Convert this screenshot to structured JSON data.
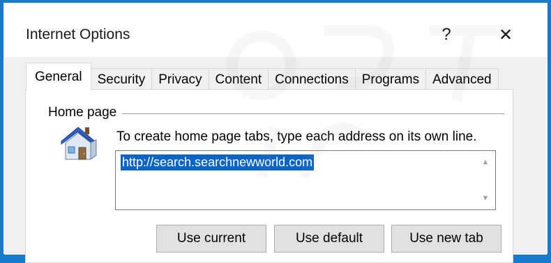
{
  "window": {
    "title": "Internet Options",
    "help_label": "?",
    "close_label": "✕"
  },
  "tabs": [
    {
      "label": "General",
      "active": true
    },
    {
      "label": "Security"
    },
    {
      "label": "Privacy"
    },
    {
      "label": "Content"
    },
    {
      "label": "Connections"
    },
    {
      "label": "Programs"
    },
    {
      "label": "Advanced"
    }
  ],
  "home_page": {
    "group_label": "Home page",
    "instruction": "To create home page tabs, type each address on its own line.",
    "url_value": "http://search.searchnewworld.com",
    "icon": "house-icon"
  },
  "buttons": {
    "use_current": "Use current",
    "use_default": "Use default",
    "use_new_tab": "Use new tab"
  },
  "colors": {
    "accent": "#1979ca",
    "selection": "#0a64c8"
  }
}
